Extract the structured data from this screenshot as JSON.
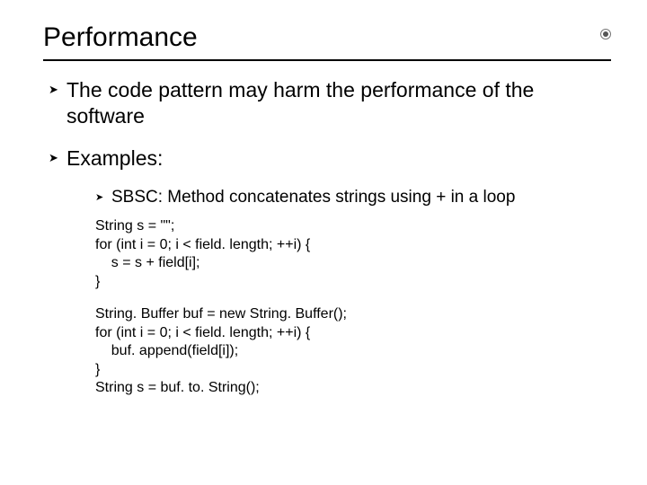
{
  "title": "Performance",
  "bullets": {
    "b1": "The code pattern may harm the performance of the software",
    "b2": "Examples:",
    "sub1": "SBSC: Method concatenates strings using + in a loop"
  },
  "code1": "String s = \"\";\nfor (int i = 0; i < field. length; ++i) {\n    s = s + field[i];\n}",
  "code2": "String. Buffer buf = new String. Buffer();\nfor (int i = 0; i < field. length; ++i) {\n    buf. append(field[i]);\n}\nString s = buf. to. String();",
  "glyphs": {
    "l1": "➤",
    "l2": "➤"
  }
}
